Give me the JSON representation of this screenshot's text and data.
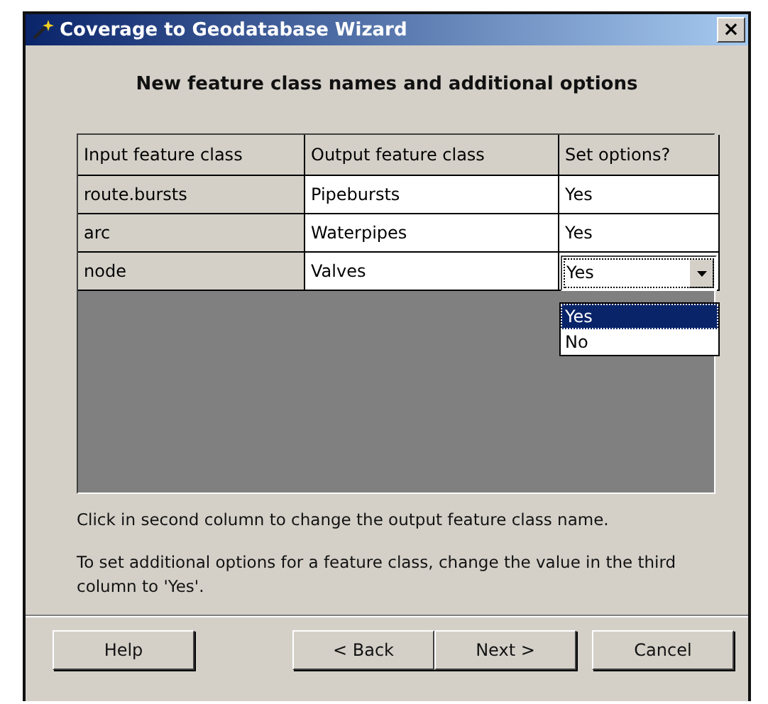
{
  "window": {
    "title": "Coverage to Geodatabase Wizard",
    "close": "×"
  },
  "heading": "New feature class names and additional options",
  "table": {
    "columns": [
      "Input feature class",
      "Output feature class",
      "Set options?"
    ],
    "rows": [
      {
        "input": "route.bursts",
        "output": "Pipebursts",
        "set_options": {
          "value": "Yes",
          "kind": "text"
        }
      },
      {
        "input": "arc",
        "output": "Waterpipes",
        "set_options": {
          "value": "Yes",
          "kind": "text"
        }
      },
      {
        "input": "node",
        "output": "Valves",
        "set_options": {
          "value": "Yes",
          "kind": "dropdown",
          "expanded": true,
          "options": [
            {
              "label": "Yes",
              "selected": true
            },
            {
              "label": "No",
              "selected": false
            }
          ]
        }
      }
    ]
  },
  "notes": [
    "Click in second column to change the output feature class name.",
    "To set additional options for a feature class, change the value in the third column to 'Yes'."
  ],
  "buttons": [
    "Help",
    "< Back",
    "Next >",
    "Cancel"
  ]
}
